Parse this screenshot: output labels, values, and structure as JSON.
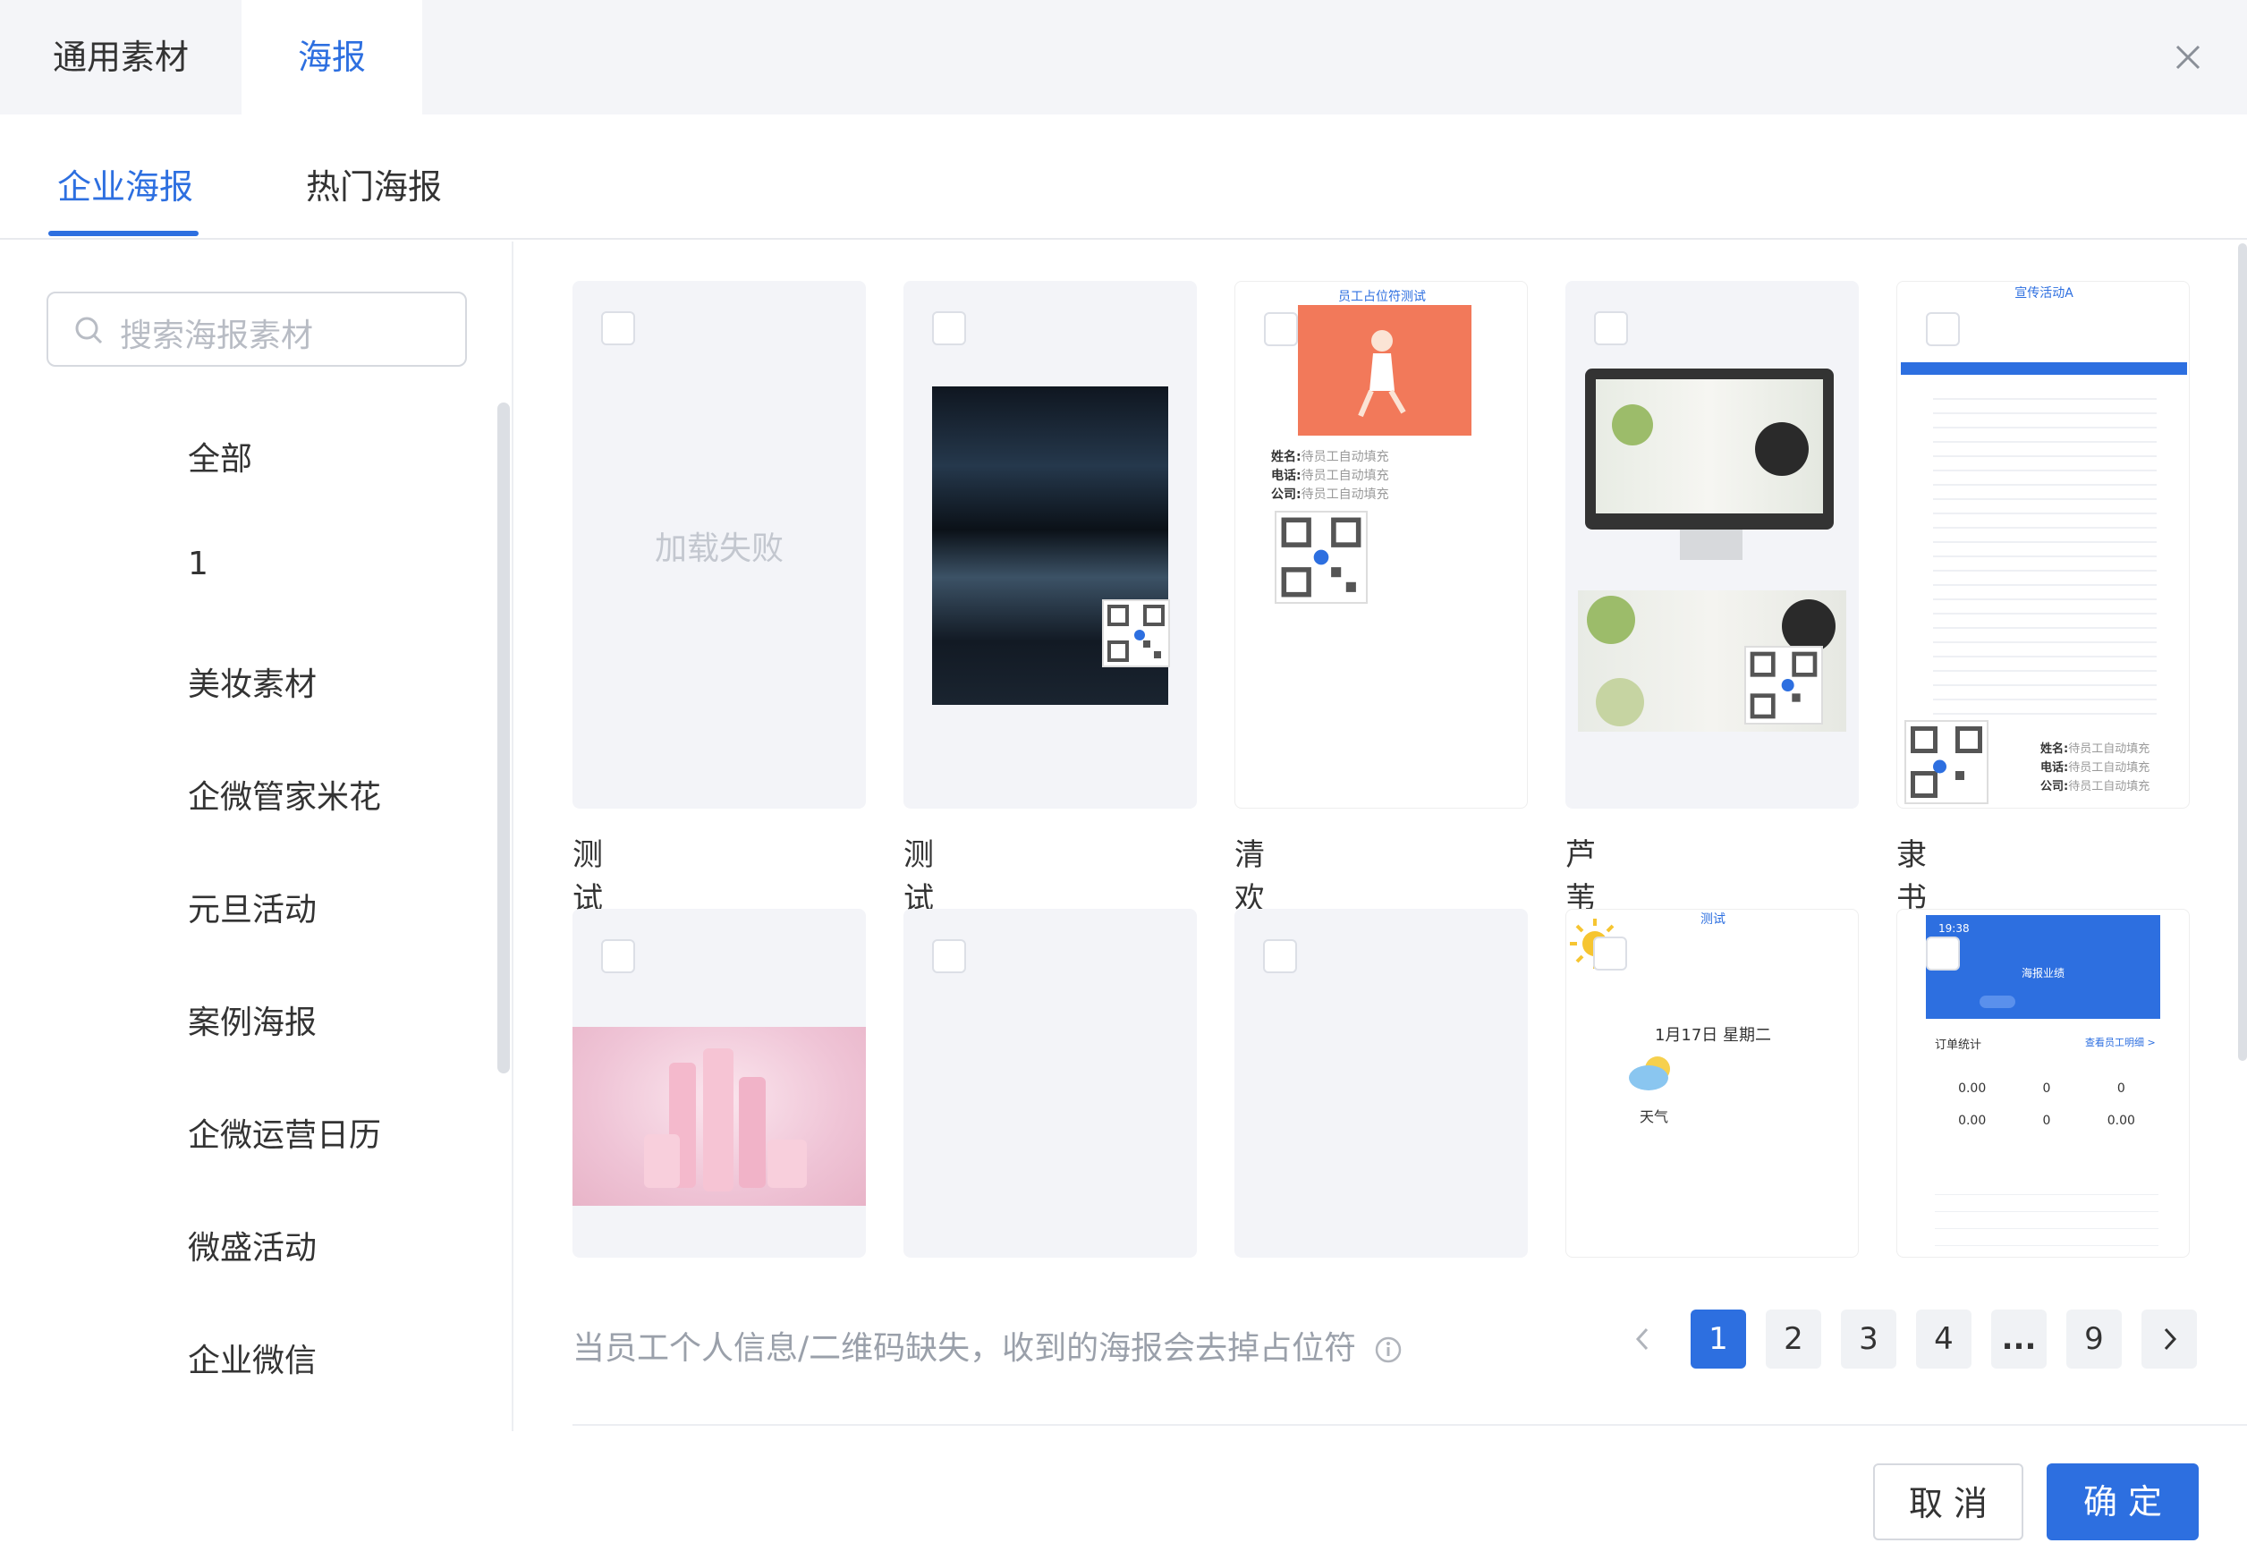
{
  "top_tabs": [
    {
      "label": "通用素材"
    },
    {
      "label": "海报"
    }
  ],
  "sub_tabs": [
    {
      "label": "企业海报"
    },
    {
      "label": "热门海报"
    }
  ],
  "search": {
    "placeholder": "搜索海报素材"
  },
  "categories": [
    {
      "label": "全部"
    },
    {
      "label": "1"
    },
    {
      "label": "美妆素材"
    },
    {
      "label": "企微管家米花"
    },
    {
      "label": "元旦活动"
    },
    {
      "label": "案例海报"
    },
    {
      "label": "企微运营日历"
    },
    {
      "label": "微盛活动"
    },
    {
      "label": "企业微信"
    }
  ],
  "posters": [
    {
      "name": "测试",
      "fail_text": "加载失败"
    },
    {
      "name": "测试"
    },
    {
      "name": "清欢员工占位符测试",
      "heading": "员工占位符测试",
      "fields": [
        "姓名:",
        "电话:",
        "公司:"
      ],
      "field_value": "待员工自动填充"
    },
    {
      "name": "芦苇测试"
    },
    {
      "name": "隶书的test",
      "heading": "宣传活动A",
      "fields": [
        "姓名:",
        "电话:",
        "公司:"
      ],
      "field_value": "待员工自动填充"
    }
  ],
  "posters_row2": [
    {
      "name": ""
    },
    {
      "name": ""
    },
    {
      "name": ""
    },
    {
      "name": "",
      "heading": "测试",
      "date": "1月17日 星期二",
      "weather": "天气"
    },
    {
      "name": "",
      "time": "19:38",
      "title": "海报业绩",
      "order_label": "订单统计",
      "link": "查看员工明细 >",
      "stats": [
        "0.00",
        "0",
        "0",
        "0.00",
        "0",
        "0.00"
      ]
    }
  ],
  "notice": "当员工个人信息/二维码缺失，收到的海报会去掉占位符",
  "pagination": {
    "pages": [
      "1",
      "2",
      "3",
      "4",
      "...",
      "9"
    ],
    "current": "1"
  },
  "footer": {
    "cancel": "取 消",
    "ok": "确 定"
  }
}
